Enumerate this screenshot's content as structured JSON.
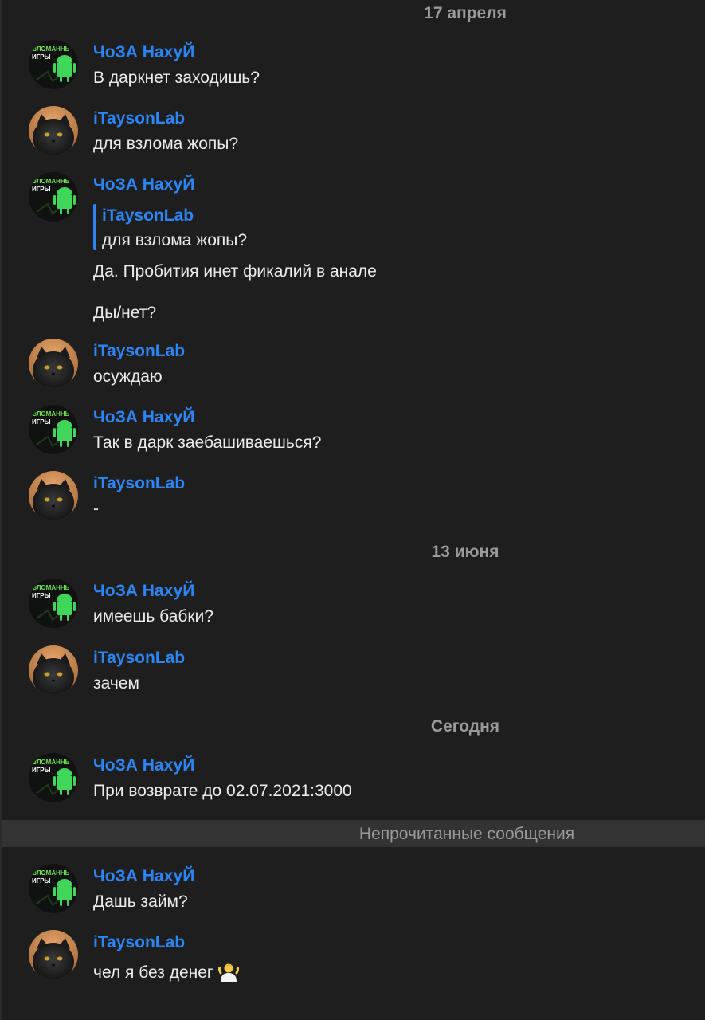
{
  "dates": {
    "d1": "17 апреля",
    "d2": "13 июня",
    "d3": "Сегодня"
  },
  "unread_label": "Непрочитанные сообщения",
  "users": {
    "a": "ЧоЗА НахуЙ",
    "b": "iTaysonLab"
  },
  "avatar_a_text": {
    "line1": "ЗЛОМАННЬ",
    "line2": "ИГРЫ"
  },
  "messages": [
    {
      "author": "ЧоЗА НахуЙ",
      "text": "В даркнет заходишь?"
    },
    {
      "author": "iTaysonLab",
      "text": "для взлома жопы?"
    },
    {
      "author": "ЧоЗА НахуЙ",
      "reply": {
        "author": "iTaysonLab",
        "text": "для взлома жопы?"
      },
      "text": "Да. Пробития инет фикалий в анале",
      "text2": "Ды/нет?"
    },
    {
      "author": "iTaysonLab",
      "text": "осуждаю"
    },
    {
      "author": "ЧоЗА НахуЙ",
      "text": "Так в дарк заебашиваешься?"
    },
    {
      "author": "iTaysonLab",
      "text": "-"
    },
    {
      "author": "ЧоЗА НахуЙ",
      "text": "имеешь бабки?"
    },
    {
      "author": "iTaysonLab",
      "text": "зачем"
    },
    {
      "author": "ЧоЗА НахуЙ",
      "text": "При возврате до 02.07.2021:3000"
    },
    {
      "author": "ЧоЗА НахуЙ",
      "text": "Дашь займ?"
    },
    {
      "author": "iTaysonLab",
      "text": "чел я без денег",
      "emoji": "person-shrugging-emoji"
    }
  ],
  "colors": {
    "background": "#1e1e1e",
    "author_name": "#2b86f5",
    "message_text": "#ececec",
    "date_text": "#9a9a9a",
    "unread_bar": "#333333"
  },
  "icons": {
    "avatar_a": "android-logo-avatar",
    "avatar_b": "black-cat-avatar"
  }
}
